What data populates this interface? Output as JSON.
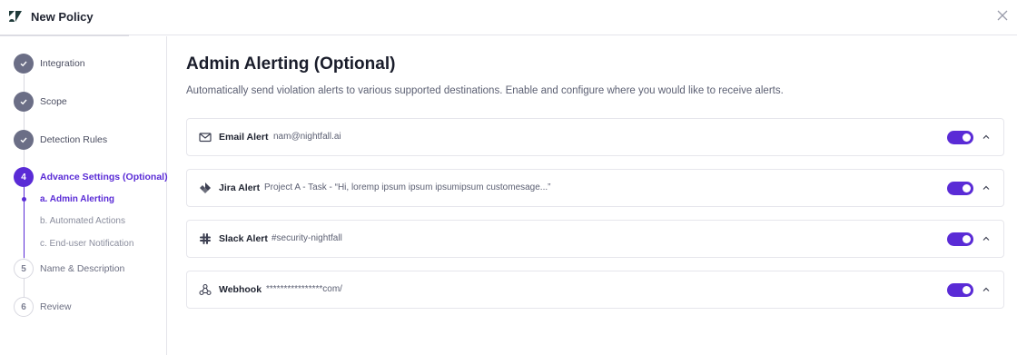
{
  "header": {
    "title": "New Policy",
    "logo_icon": "zendesk-logo",
    "close_icon": "close-icon"
  },
  "sidebar": {
    "steps": [
      {
        "marker": "",
        "label": "Integration",
        "state": "done"
      },
      {
        "marker": "",
        "label": "Scope",
        "state": "done"
      },
      {
        "marker": "",
        "label": "Detection Rules",
        "state": "done"
      },
      {
        "marker": "4",
        "label": "Advance Settings (Optional)",
        "state": "active"
      },
      {
        "marker": "5",
        "label": "Name & Description",
        "state": "todo"
      },
      {
        "marker": "6",
        "label": "Review",
        "state": "todo"
      }
    ],
    "substeps": [
      {
        "label": "a. Admin Alerting",
        "state": "active"
      },
      {
        "label": "b. Automated Actions",
        "state": "todo"
      },
      {
        "label": "c. End-user Notification",
        "state": "todo"
      }
    ]
  },
  "main": {
    "title": "Admin Alerting (Optional)",
    "description": "Automatically send violation alerts to various supported destinations. Enable and configure where you would like to receive alerts."
  },
  "alerts": [
    {
      "name": "Email Alert",
      "detail": "nam@nightfall.ai",
      "icon": "mail-icon",
      "enabled": true
    },
    {
      "name": "Jira Alert",
      "detail": "Project A - Task - “Hi, loremp ipsum ipsum ipsumipsum customesage...”",
      "icon": "jira-icon",
      "enabled": true
    },
    {
      "name": "Slack Alert",
      "detail": "#security-nightfall",
      "icon": "slack-icon",
      "enabled": true
    },
    {
      "name": "Webhook",
      "detail": "****************com/",
      "icon": "webhook-icon",
      "enabled": true
    }
  ],
  "colors": {
    "accent": "#5a2bd6",
    "done_step": "#6b6e86"
  }
}
